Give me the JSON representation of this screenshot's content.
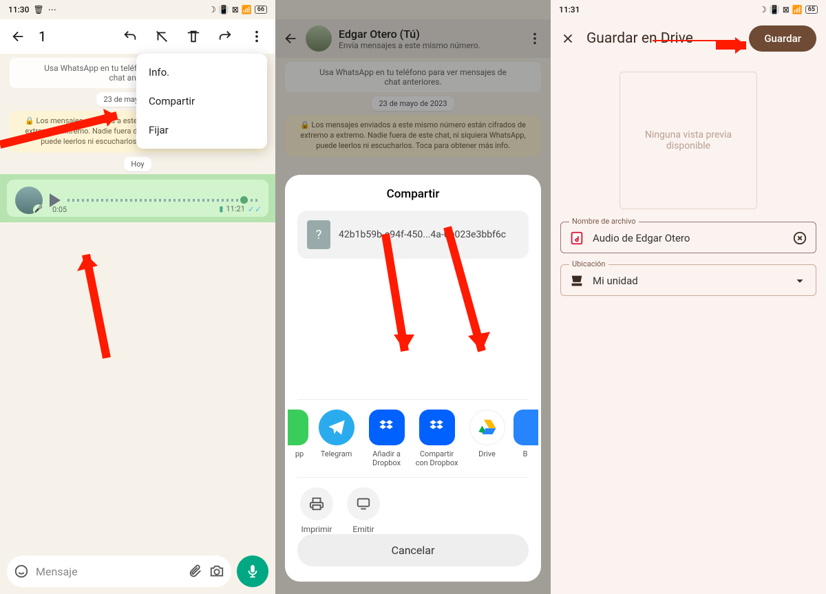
{
  "p1": {
    "time": "11:30",
    "battery": "66",
    "selected_count": "1",
    "chat_info": "Usa WhatsApp en tu teléfono para ver mensajes de chat anteriores.",
    "date1": "23 de mayo de 2023",
    "encryption": "🔒 Los mensajes enviados a este mismo número están cifrados de extremo a extremo. Nadie fuera de este chat, ni siquiera WhatsApp, puede leerlos ni escucharlos. Toca para obtener más info.",
    "date2": "Hoy",
    "voice": {
      "dur": "0:05",
      "time": "11:21"
    },
    "menu": {
      "info": "Info.",
      "share": "Compartir",
      "pin": "Fijar"
    },
    "msg_placeholder": "Mensaje"
  },
  "p2": {
    "name": "Edgar Otero (Tú)",
    "sub": "Envía mensajes a este mismo número.",
    "chat_info": "Usa WhatsApp en tu teléfono para ver mensajes de chat anteriores.",
    "date": "23 de mayo de 2023",
    "encryption": "🔒 Los mensajes enviados a este mismo número están cifrados de extremo a extremo. Nadie fuera de este chat, ni siquiera WhatsApp, puede leerlos ni escucharlos. Toca para obtener más info.",
    "sheet_title": "Compartir",
    "file_name": "42b1b59b-e94f-450...4a-0b023e3bbf6c",
    "apps": {
      "a0": "pp",
      "a1": "Telegram",
      "a2": "Añadir a Dropbox",
      "a3": "Compartir con Dropbox",
      "a4": "Drive",
      "a5": "B"
    },
    "actions": {
      "print": "Imprimir",
      "cast": "Emitir"
    },
    "cancel": "Cancelar"
  },
  "p3": {
    "time": "11:31",
    "battery": "65",
    "title": "Guardar en Drive",
    "save": "Guardar",
    "preview": "Ninguna vista previa disponible",
    "filename_label": "Nombre de archivo",
    "filename_value": "Audio de Edgar Otero",
    "location_label": "Ubicación",
    "location_value": "Mi unidad"
  }
}
